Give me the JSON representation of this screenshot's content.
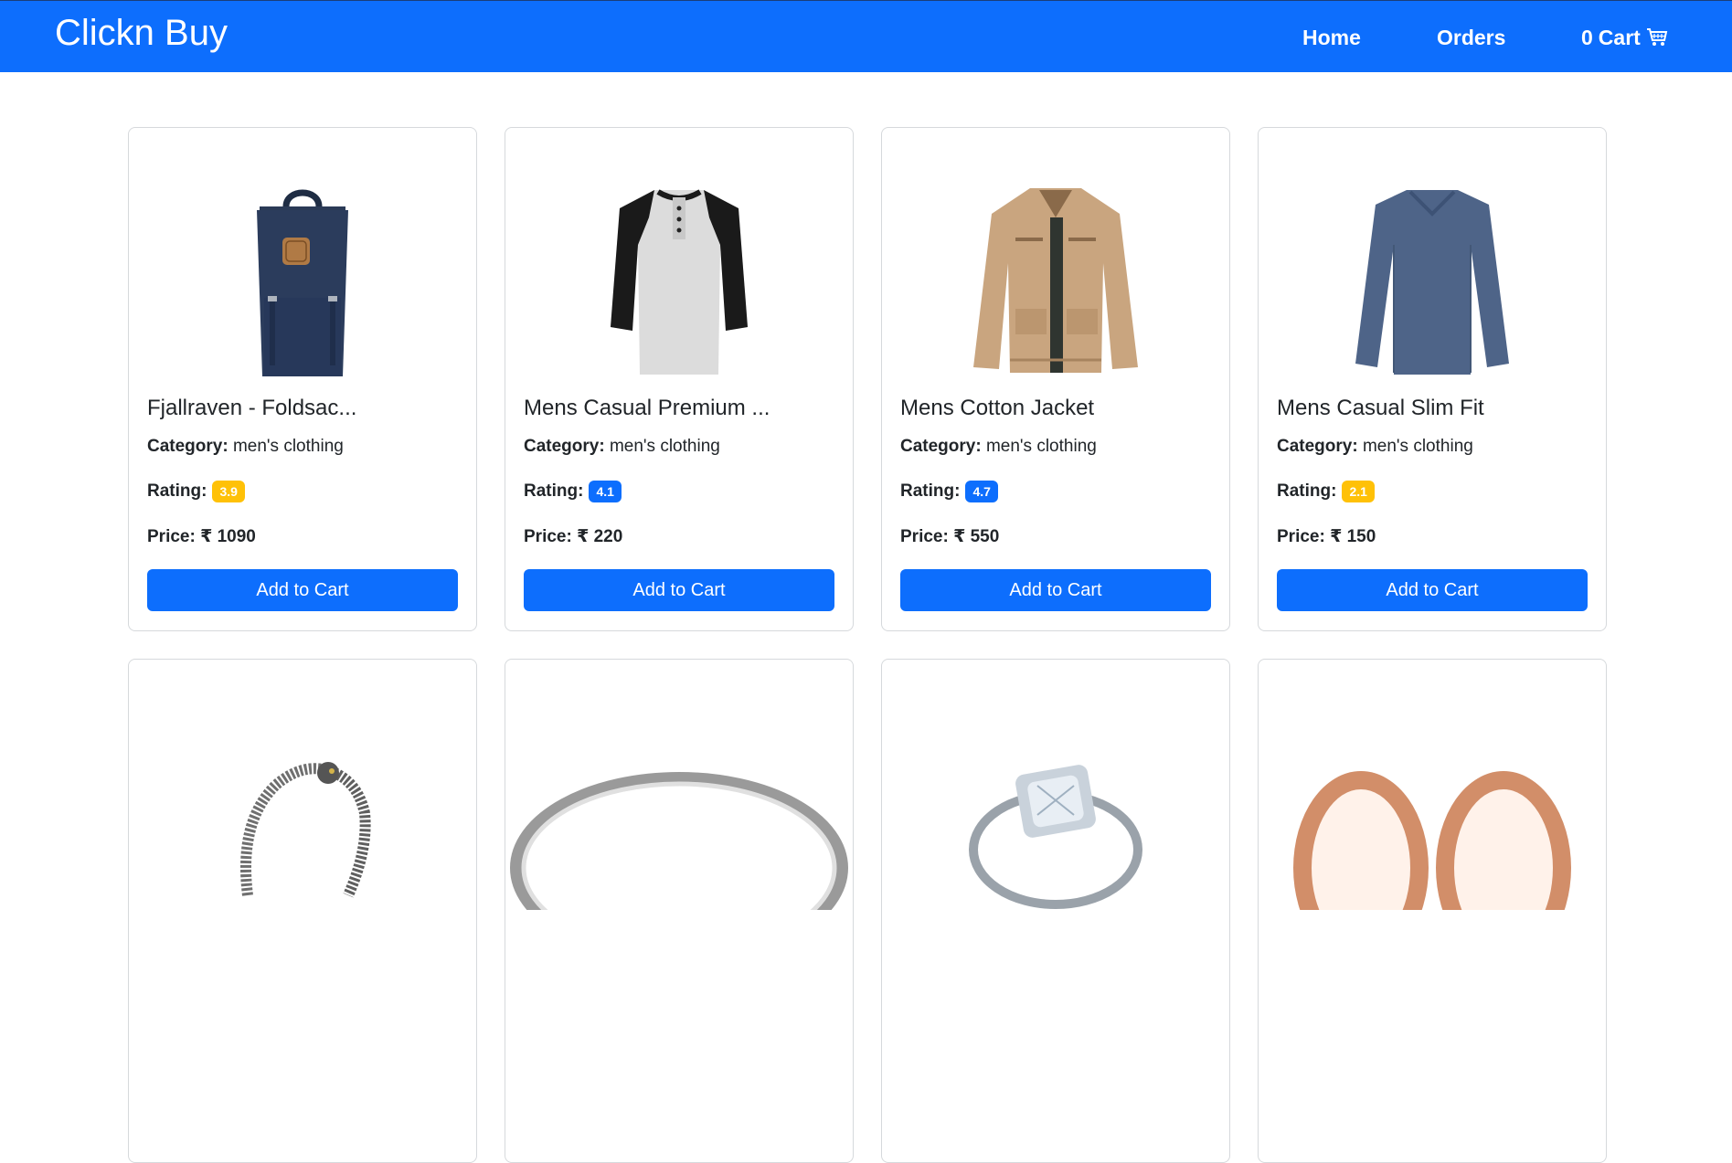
{
  "navbar": {
    "brand": "Clickn Buy",
    "home_label": "Home",
    "orders_label": "Orders",
    "cart_count": "0",
    "cart_label": "Cart",
    "cart_icon": "shopping-cart-icon"
  },
  "colors": {
    "primary": "#0d6efd",
    "warning": "#ffc107"
  },
  "labels": {
    "category": "Category:",
    "rating": "Rating:",
    "price": "Price:",
    "currency": "₹",
    "add_to_cart": "Add to Cart"
  },
  "products": [
    {
      "title": "Fjallraven - Foldsac...",
      "category": "men's clothing",
      "rating": "3.9",
      "rating_color": "yellow",
      "price": "1090",
      "image": "backpack"
    },
    {
      "title": "Mens Casual Premium ...",
      "category": "men's clothing",
      "rating": "4.1",
      "rating_color": "blue",
      "price": "220",
      "image": "raglan-tshirt"
    },
    {
      "title": "Mens Cotton Jacket",
      "category": "men's clothing",
      "rating": "4.7",
      "rating_color": "blue",
      "price": "550",
      "image": "jacket"
    },
    {
      "title": "Mens Casual Slim Fit",
      "category": "men's clothing",
      "rating": "2.1",
      "rating_color": "yellow",
      "price": "150",
      "image": "longsleeve-shirt"
    },
    {
      "image": "chain-bracelet"
    },
    {
      "image": "silver-ring"
    },
    {
      "image": "diamond-ring"
    },
    {
      "image": "rose-gold-plugs"
    }
  ]
}
